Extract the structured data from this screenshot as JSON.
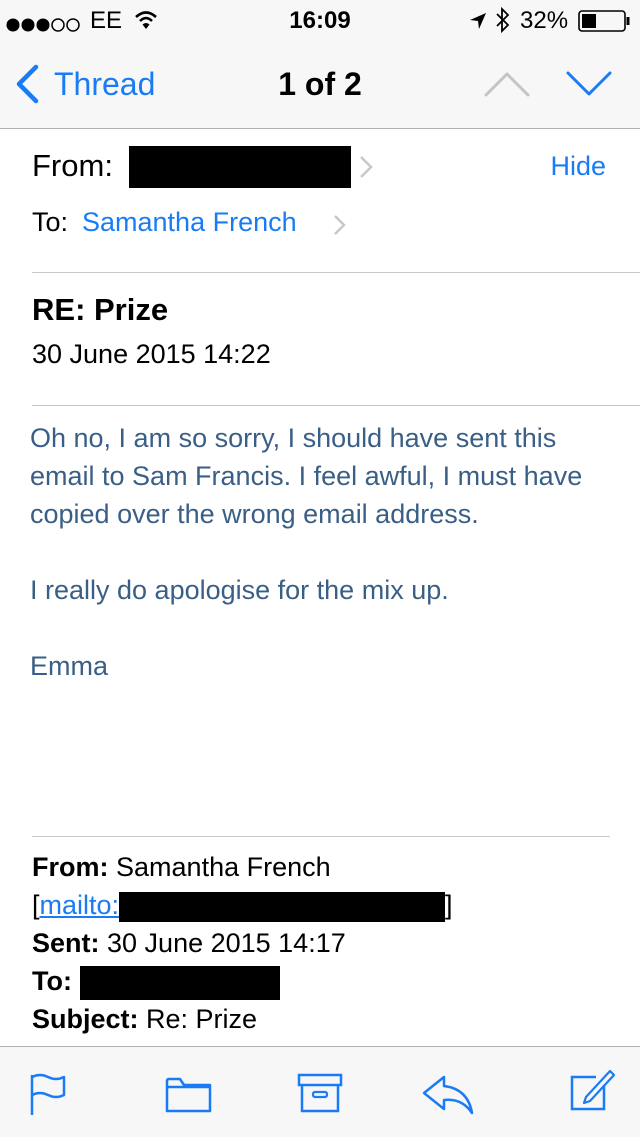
{
  "status_bar": {
    "carrier": "EE",
    "time": "16:09",
    "battery": "32%"
  },
  "nav": {
    "back_label": "Thread",
    "position": "1 of 2"
  },
  "header": {
    "from_label": "From:",
    "hide_label": "Hide",
    "to_label": "To:",
    "to_value": "Samantha French"
  },
  "message": {
    "subject": "RE: Prize",
    "date": "30 June 2015 14:22",
    "paragraph1": "Oh no, I am so sorry, I should have sent this email to Sam Francis.  I feel awful, I must have copied over the wrong email address.",
    "paragraph2": "I really do apologise for the mix up.",
    "signature": "Emma"
  },
  "quoted": {
    "from_label": "From:",
    "from_value": "Samantha French",
    "mailto_prefix": "[",
    "mailto_label": "mailto:",
    "mailto_suffix": "]",
    "sent_label": "Sent:",
    "sent_value": "30 June 2015 14:17",
    "to_label": "To:",
    "subject_label": "Subject:",
    "subject_value": "Re: Prize"
  },
  "colors": {
    "accent": "#1a7cf5",
    "body_text": "#3a5f86"
  }
}
